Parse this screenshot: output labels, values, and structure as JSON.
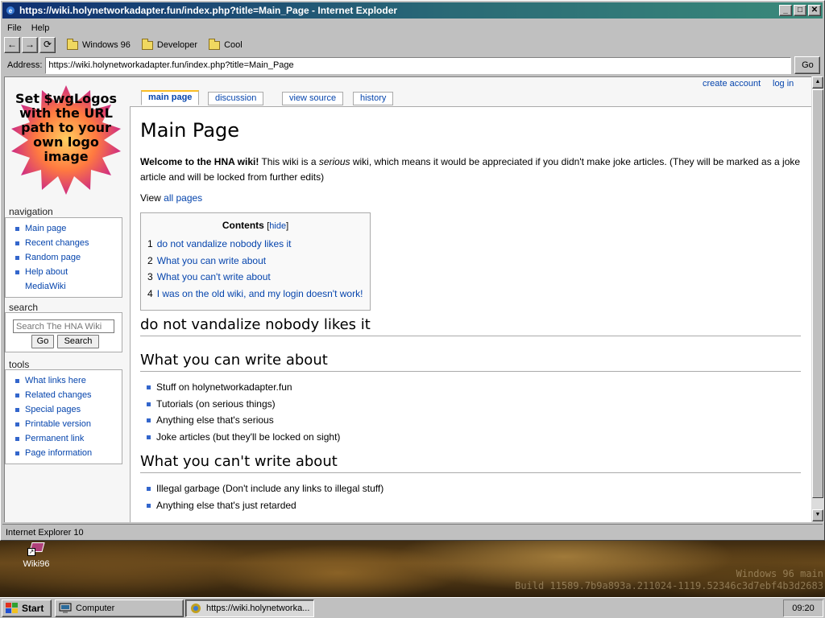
{
  "window": {
    "title": "https://wiki.holynetworkadapter.fun/index.php?title=Main_Page - Internet Exploder",
    "minimize": "_",
    "maximize": "□",
    "close": "✕"
  },
  "menu": [
    "File",
    "Help"
  ],
  "toolbar": {
    "back": "←",
    "forward": "→",
    "refresh": "⟳",
    "favorites": [
      "Windows 96",
      "Developer",
      "Cool"
    ]
  },
  "address": {
    "label": "Address:",
    "value": "https://wiki.holynetworkadapter.fun/index.php?title=Main_Page",
    "go": "Go"
  },
  "status": "Internet Explorer 10",
  "wiki": {
    "logo_text": "Set $wgLogos with the URL path to your own logo image",
    "personal": [
      "create account",
      "log in"
    ],
    "tabs": [
      "main page",
      "discussion",
      "view source",
      "history"
    ],
    "navigation": {
      "heading": "navigation",
      "items": [
        "Main page",
        "Recent changes",
        "Random page",
        "Help about MediaWiki"
      ]
    },
    "search": {
      "heading": "search",
      "placeholder": "Search The HNA Wiki",
      "go": "Go",
      "search": "Search"
    },
    "tools": {
      "heading": "tools",
      "items": [
        "What links here",
        "Related changes",
        "Special pages",
        "Printable version",
        "Permanent link",
        "Page information"
      ]
    },
    "page_title": "Main Page",
    "intro_bold": "Welcome to the HNA wiki!",
    "intro_pre": " This wiki is a ",
    "intro_em": "serious",
    "intro_post": " wiki, which means it would be appreciated if you didn't make joke articles. (They will be marked as a joke article and will be locked from further edits)",
    "view_all_pre": "View ",
    "view_all_link": "all pages",
    "toc": {
      "title": "Contents",
      "hide": "hide",
      "items": [
        {
          "num": "1",
          "text": "do not vandalize nobody likes it"
        },
        {
          "num": "2",
          "text": "What you can write about"
        },
        {
          "num": "3",
          "text": "What you can't write about"
        },
        {
          "num": "4",
          "text": "I was on the old wiki, and my login doesn't work!"
        }
      ]
    },
    "sections": [
      {
        "heading": "do not vandalize nobody likes it",
        "items": []
      },
      {
        "heading": "What you can write about",
        "items": [
          "Stuff on holynetworkadapter.fun",
          "Tutorials (on serious things)",
          "Anything else that's serious",
          "Joke articles (but they'll be locked on sight)"
        ]
      },
      {
        "heading": "What you can't write about",
        "items": [
          "Illegal garbage (Don't include any links to illegal stuff)",
          "Anything else that's just retarded"
        ]
      }
    ]
  },
  "desktop": {
    "icon_label": "Wiki96",
    "watermark_line1": "Windows 96 main",
    "watermark_line2": "Build 11589.7b9a893a.211024-1119.52346c3d7ebf4b3d2683"
  },
  "taskbar": {
    "start": "Start",
    "tasks": [
      "Computer",
      "https://wiki.holynetworka..."
    ],
    "clock": "09:20"
  }
}
